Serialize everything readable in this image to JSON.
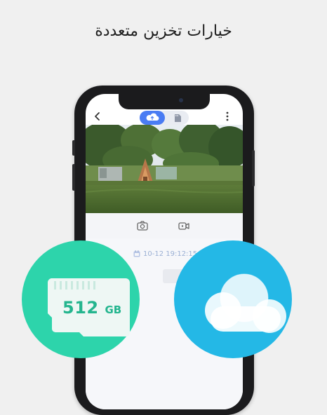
{
  "headline": "خيارات تخزين متعددة",
  "app": {
    "back_icon": "chevron-left-icon",
    "more_icon": "more-vertical-icon",
    "storage_toggle": {
      "active": "cloud",
      "cloud_icon": "cloud-upload-icon",
      "sd_icon": "sd-card-icon"
    },
    "controls": {
      "snapshot_icon": "camera-icon",
      "record_icon": "video-record-icon"
    },
    "timeline": {
      "calendar_icon": "calendar-icon",
      "timestamp": "10-12 19:12:15"
    }
  },
  "badges": {
    "sd_card": {
      "capacity_value": "512",
      "capacity_unit": "GB",
      "color": "#2dd4ab"
    },
    "cloud": {
      "icon": "cloud-icon",
      "color": "#24b8e6"
    }
  },
  "colors": {
    "accent_blue": "#4a7cf3",
    "background": "#f0f0f0"
  }
}
